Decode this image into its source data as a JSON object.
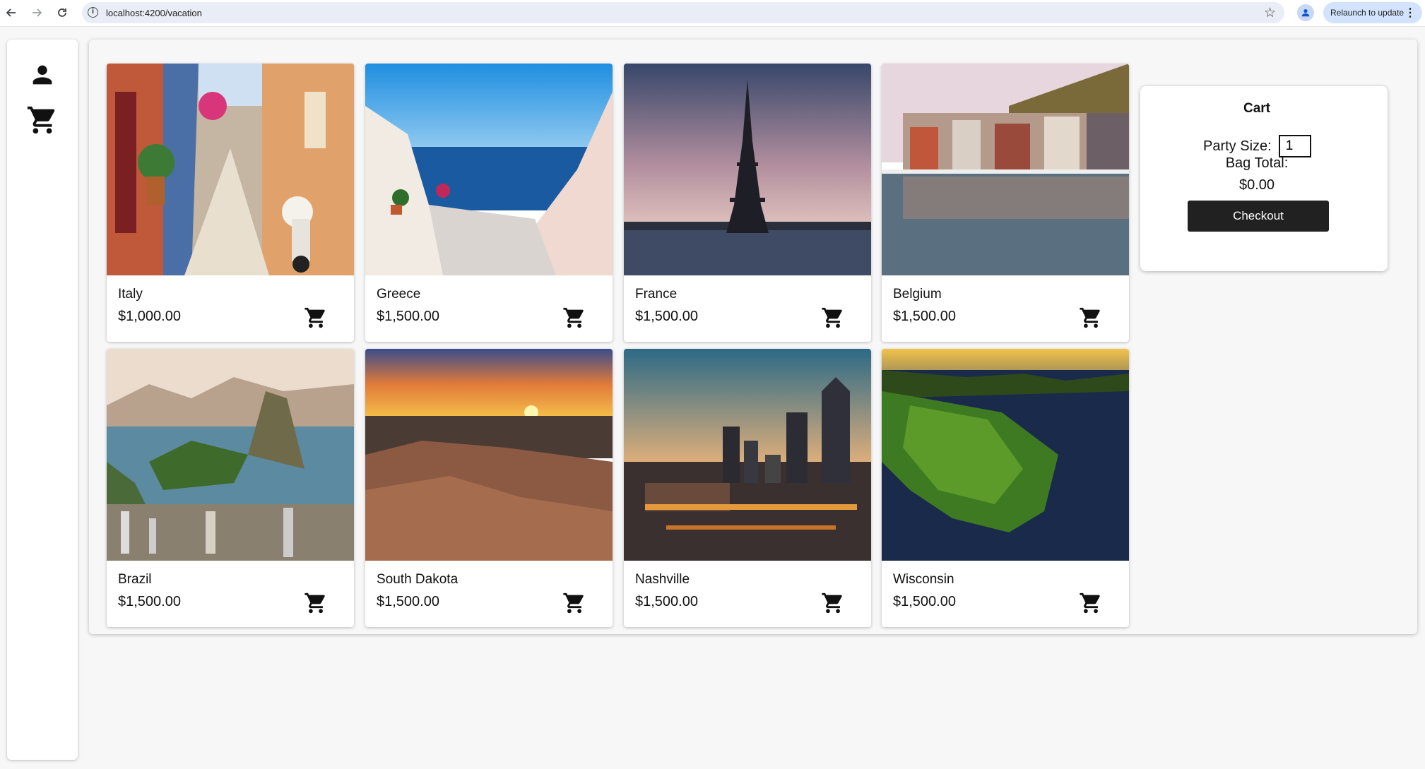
{
  "browser": {
    "url": "localhost:4200/vacation",
    "relaunch_label": "Relaunch to update",
    "back_icon": "arrow-left-icon",
    "forward_icon": "arrow-right-icon",
    "reload_icon": "reload-icon",
    "bookmark_icon": "star-icon"
  },
  "sidebar": {
    "items": [
      {
        "icon": "person-icon"
      },
      {
        "icon": "shopping-cart-icon"
      }
    ]
  },
  "destinations": [
    {
      "name": "Italy",
      "price": "$1,000.00"
    },
    {
      "name": "Greece",
      "price": "$1,500.00"
    },
    {
      "name": "France",
      "price": "$1,500.00"
    },
    {
      "name": "Belgium",
      "price": "$1,500.00"
    },
    {
      "name": "Brazil",
      "price": "$1,500.00"
    },
    {
      "name": "South Dakota",
      "price": "$1,500.00"
    },
    {
      "name": "Nashville",
      "price": "$1,500.00"
    },
    {
      "name": "Wisconsin",
      "price": "$1,500.00"
    }
  ],
  "cart": {
    "title": "Cart",
    "party_size_label": "Party Size:",
    "party_size_value": "1",
    "bag_total_label": "Bag Total:",
    "bag_total_value": "$0.00",
    "checkout_label": "Checkout"
  },
  "colors": {
    "button_dark": "#212121",
    "page_bg": "#f7f7f8",
    "relaunch_bg": "#d3e3fd"
  }
}
